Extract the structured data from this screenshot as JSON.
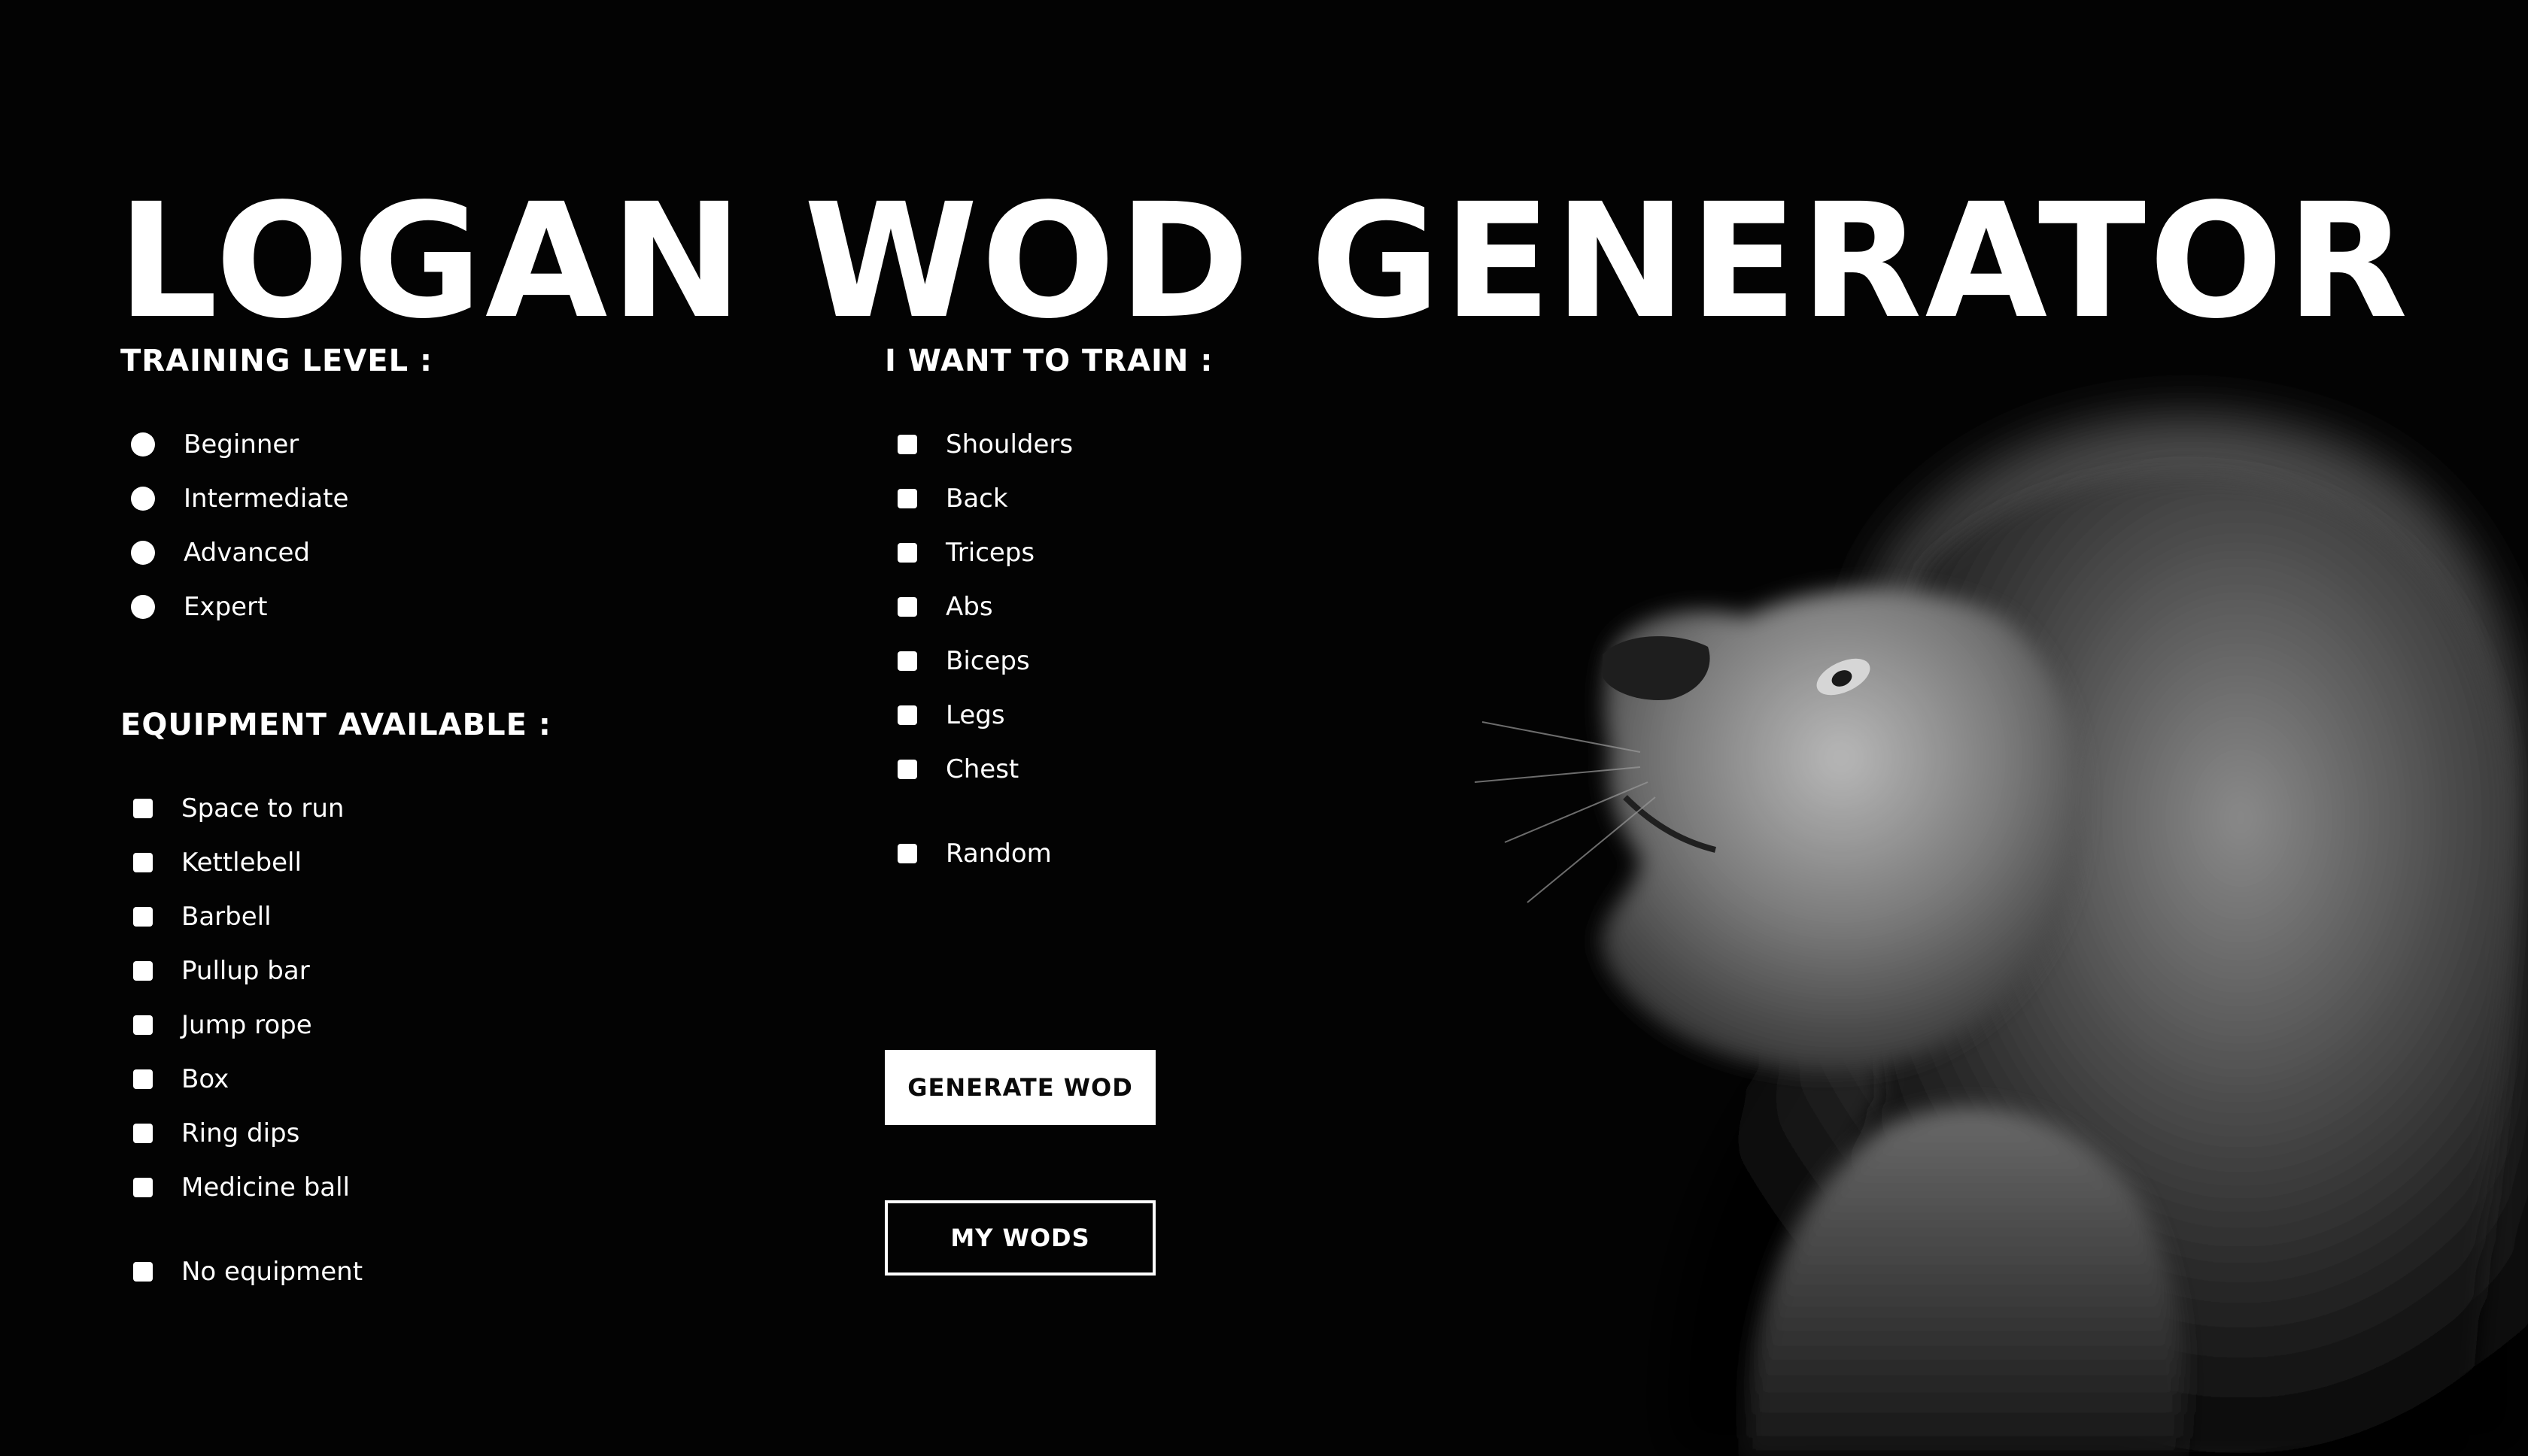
{
  "title": "LOGAN WOD GENERATOR",
  "training_level": {
    "heading": "TRAINING LEVEL :",
    "options": [
      "Beginner",
      "Intermediate",
      "Advanced",
      "Expert"
    ]
  },
  "equipment": {
    "heading": "EQUIPMENT AVAILABLE :",
    "options": [
      "Space to run",
      "Kettlebell",
      "Barbell",
      "Pullup bar",
      "Jump rope",
      "Box",
      "Ring dips",
      "Medicine ball",
      "No equipment"
    ]
  },
  "train": {
    "heading": "I WANT TO TRAIN :",
    "options": [
      "Shoulders",
      "Back",
      "Triceps",
      "Abs",
      "Biceps",
      "Legs",
      "Chest",
      "Random"
    ]
  },
  "buttons": {
    "generate": "GENERATE WOD",
    "my_wods": "MY WODS"
  },
  "colors": {
    "background": "#030303",
    "text": "#ffffff"
  },
  "image": {
    "icon": "lion-photo"
  }
}
